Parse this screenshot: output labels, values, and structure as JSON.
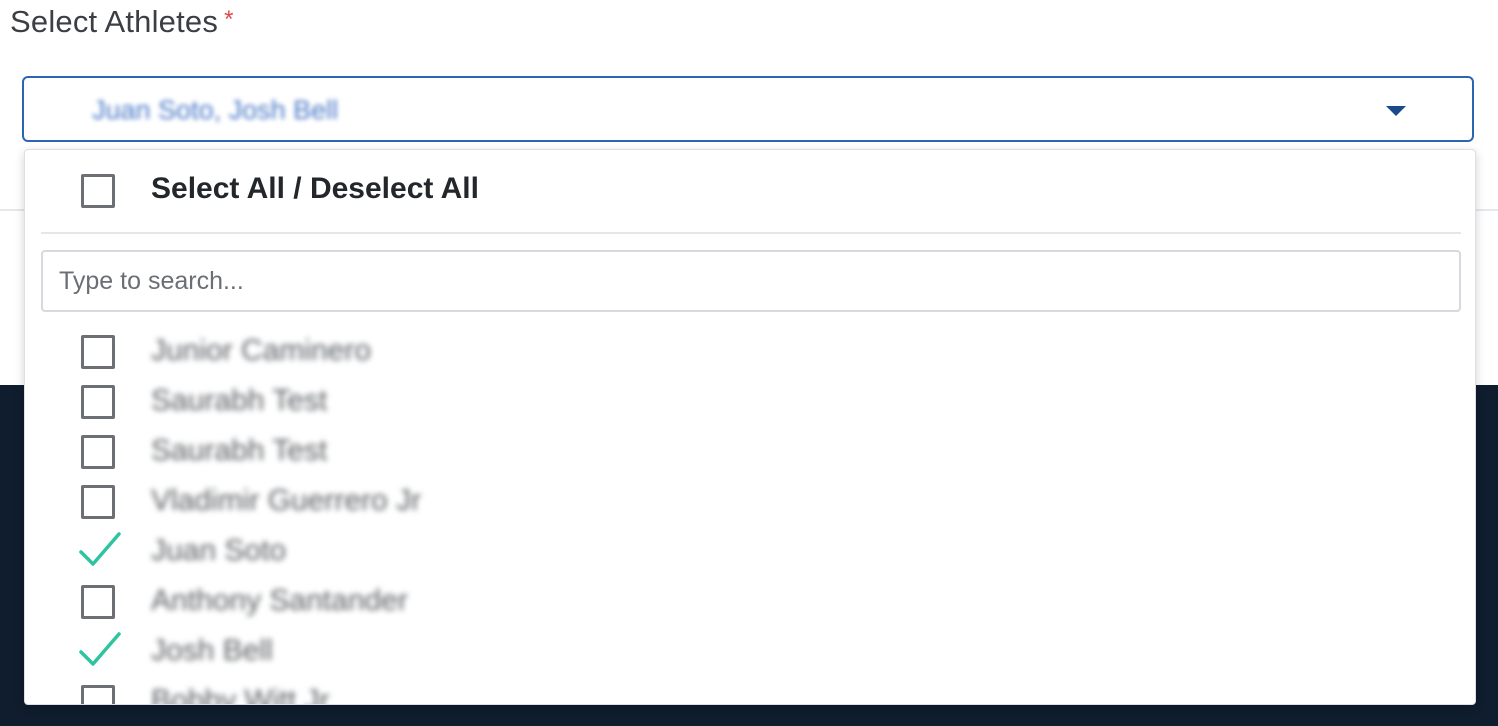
{
  "field": {
    "label": "Select Athletes",
    "required_marker": "*"
  },
  "select": {
    "value": "Juan Soto, Josh Bell"
  },
  "dropdown": {
    "select_all_label": "Select All / Deselect All",
    "search_placeholder": "Type to search...",
    "options": [
      {
        "label": "Junior Caminero",
        "checked": false
      },
      {
        "label": "Saurabh Test",
        "checked": false
      },
      {
        "label": "Saurabh Test",
        "checked": false
      },
      {
        "label": "Vladimir Guerrero Jr",
        "checked": false
      },
      {
        "label": "Juan Soto",
        "checked": true
      },
      {
        "label": "Anthony Santander",
        "checked": false
      },
      {
        "label": "Josh Bell",
        "checked": true
      },
      {
        "label": "Bobby Witt Jr",
        "checked": false
      }
    ]
  },
  "colors": {
    "accent_border": "#2b66b1",
    "check_mark": "#2ec4a0",
    "required": "#e0464a",
    "backdrop_dark": "#0f1d2e"
  }
}
